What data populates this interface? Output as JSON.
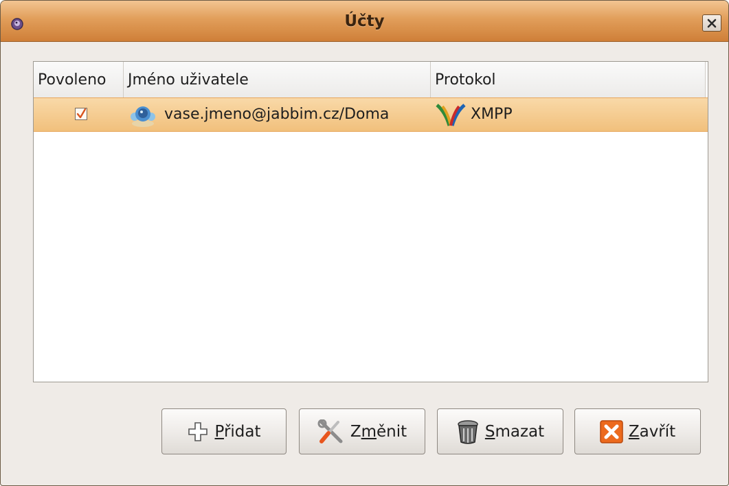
{
  "window": {
    "title": "Účty",
    "app_icon": "pidgin-icon",
    "close_icon": "close-icon"
  },
  "accounts_table": {
    "columns": [
      "Povoleno",
      "Jméno uživatele",
      "Protokol"
    ],
    "rows": [
      {
        "enabled": true,
        "username": "vase.jmeno@jabbim.cz/Doma",
        "user_icon": "buddy-icon",
        "protocol": "XMPP",
        "protocol_icon": "xmpp-icon"
      }
    ]
  },
  "buttons": {
    "add": {
      "pre": "",
      "mnemonic": "P",
      "post": "řidat",
      "icon": "plus-icon"
    },
    "modify": {
      "pre": "Z",
      "mnemonic": "m",
      "post": "ěnit",
      "icon": "tools-icon"
    },
    "delete": {
      "pre": "",
      "mnemonic": "S",
      "post": "mazat",
      "icon": "trash-icon"
    },
    "close": {
      "pre": "",
      "mnemonic": "Z",
      "post": "avřít",
      "icon": "close-x-icon"
    }
  },
  "colors": {
    "titlebar": "#e19e5a",
    "selection": "#f1c07c",
    "checkmark": "#d9541e"
  }
}
